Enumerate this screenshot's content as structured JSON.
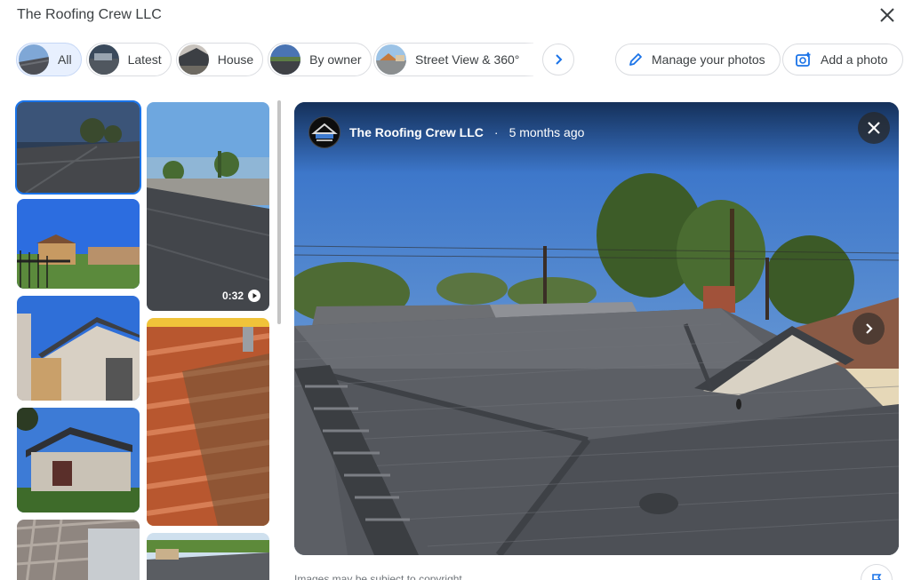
{
  "header": {
    "title": "The Roofing Crew LLC",
    "close_icon": "close-icon"
  },
  "chips": [
    {
      "label": "All",
      "active": true
    },
    {
      "label": "Latest",
      "active": false
    },
    {
      "label": "House",
      "active": false
    },
    {
      "label": "By owner",
      "active": false
    },
    {
      "label": "Street View & 360°",
      "active": false
    }
  ],
  "chip_next_icon": "chevron-right-icon",
  "actions": {
    "manage_label": "Manage your photos",
    "add_label": "Add a photo"
  },
  "gallery": {
    "video_duration": "0:32",
    "selected_index": 0
  },
  "viewer": {
    "owner_name": "The Roofing Crew LLC",
    "separator": "·",
    "posted_ago": "5 months ago",
    "close_icon": "close-icon",
    "next_icon": "chevron-right-icon"
  },
  "footer": {
    "copyright": "Images may be subject to copyright."
  },
  "colors": {
    "accent": "#1a73e8",
    "chip_active_bg": "#e8f0fe",
    "border": "#dadce0"
  }
}
